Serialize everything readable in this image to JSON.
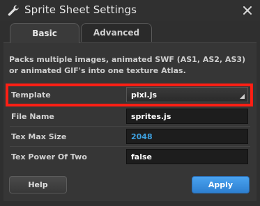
{
  "window": {
    "title": "Sprite Sheet Settings",
    "icon": "wrench-icon",
    "close_icon": "close-icon"
  },
  "tabs": [
    {
      "label": "Basic",
      "active": true
    },
    {
      "label": "Advanced",
      "active": false
    }
  ],
  "description": "Packs multiple images, animated SWF (AS1, AS2, AS3) or animated GIF's into one texture Atlas.",
  "fields": {
    "template": {
      "label": "Template",
      "value": "pixi.js"
    },
    "file_name": {
      "label": "File Name",
      "value": "sprites.js"
    },
    "tex_max_size": {
      "label": "Tex Max Size",
      "value": "2048"
    },
    "tex_power_of_two": {
      "label": "Tex Power Of Two",
      "value": "false"
    }
  },
  "buttons": {
    "help": "Help",
    "apply": "Apply"
  },
  "colors": {
    "highlight": "#ff1f14",
    "accent_blue": "#3ea1e0",
    "apply_button": "#2d7fd0"
  }
}
